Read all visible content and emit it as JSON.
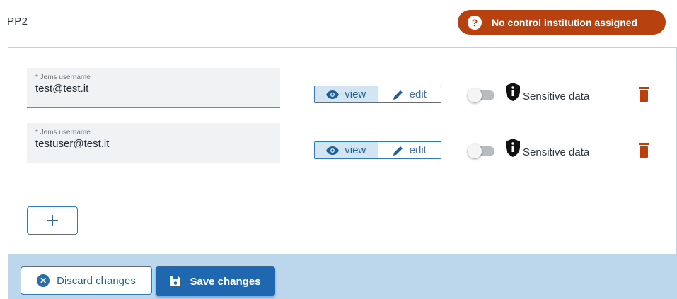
{
  "section": {
    "title": "PP2"
  },
  "status_badge": {
    "icon": "question-icon",
    "icon_glyph": "?",
    "text": "No control institution assigned",
    "color": "#b8420f"
  },
  "users": [
    {
      "label": "* Jems username",
      "value": "test@test.it",
      "permission_options": [
        "view",
        "edit"
      ],
      "selected_permission": "view",
      "sensitive_toggle": false,
      "sensitive_label": "Sensitive data"
    },
    {
      "label": "* Jems username",
      "value": "testuser@test.it",
      "permission_options": [
        "view",
        "edit"
      ],
      "selected_permission": "view",
      "sensitive_toggle": false,
      "sensitive_label": "Sensitive data"
    }
  ],
  "add_button": {
    "icon": "plus-icon"
  },
  "footer": {
    "discard_label": "Discard changes",
    "discard_icon": "close-circle-icon",
    "save_label": "Save changes",
    "save_icon": "floppy-disk-icon"
  },
  "colors": {
    "accent": "#1f68b0",
    "danger": "#b8420f",
    "footer_bg": "#bcd6eb"
  }
}
